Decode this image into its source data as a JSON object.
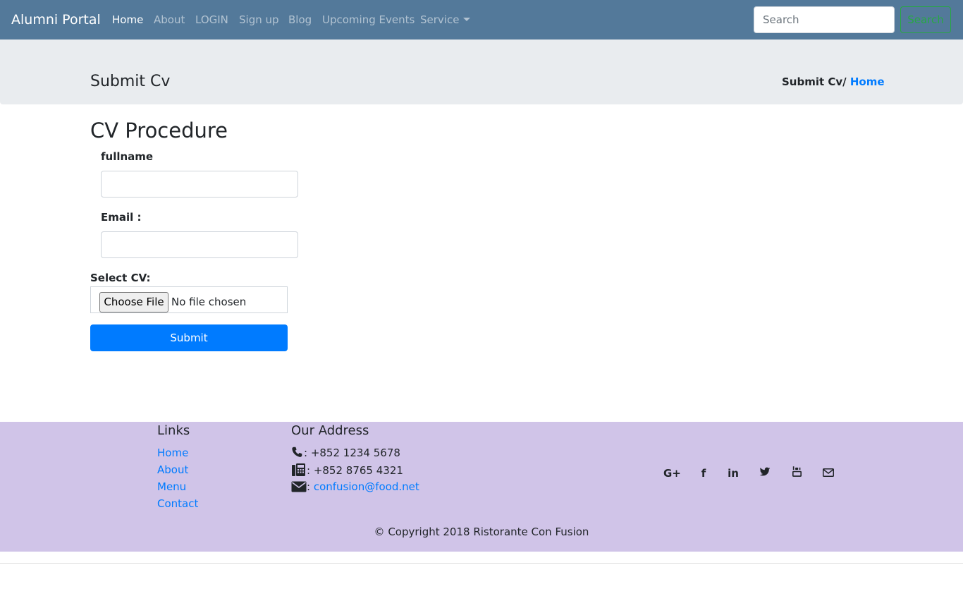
{
  "navbar": {
    "brand": "Alumni Portal",
    "items": [
      {
        "label": "Home"
      },
      {
        "label": "About"
      },
      {
        "label": "LOGIN"
      },
      {
        "label": "Sign up"
      },
      {
        "label": "Blog"
      },
      {
        "label": "Upcoming Events"
      },
      {
        "label": "Service"
      }
    ],
    "search_placeholder": "Search",
    "search_button": "Search"
  },
  "header": {
    "title": "Submit Cv",
    "breadcrumb_current": "Submit Cv/ ",
    "breadcrumb_link": "Home"
  },
  "form": {
    "heading": "CV Procedure",
    "fullname_label": "fullname",
    "fullname_value": "",
    "email_label": "Email :",
    "email_value": "",
    "cv_label": "Select CV:",
    "file_button": "Choose File",
    "file_status": "No file chosen",
    "submit": "Submit"
  },
  "footer": {
    "links_heading": "Links",
    "links": [
      {
        "label": "Home"
      },
      {
        "label": "About"
      },
      {
        "label": "Menu"
      },
      {
        "label": "Contact"
      }
    ],
    "address_heading": "Our Address",
    "phone": ": +852 1234 5678",
    "fax": ": +852 8765 4321",
    "email_prefix": ": ",
    "email": "confusion@food.net",
    "social": [
      {
        "icon": "google-plus-icon",
        "glyph": "G+"
      },
      {
        "icon": "facebook-icon",
        "glyph": "f"
      },
      {
        "icon": "linkedin-icon",
        "glyph": "in"
      },
      {
        "icon": "twitter-icon",
        "glyph": "🐦"
      },
      {
        "icon": "youtube-icon",
        "glyph": "▶"
      },
      {
        "icon": "mail-icon",
        "glyph": "✉"
      }
    ],
    "copyright": "© Copyright 2018 Ristorante Con Fusion"
  },
  "colors": {
    "navbar_bg": "#53799a",
    "jumbo_bg": "#e9ecef",
    "footer_bg": "#d0c4e8",
    "primary": "#007bff",
    "success": "#28a745"
  }
}
